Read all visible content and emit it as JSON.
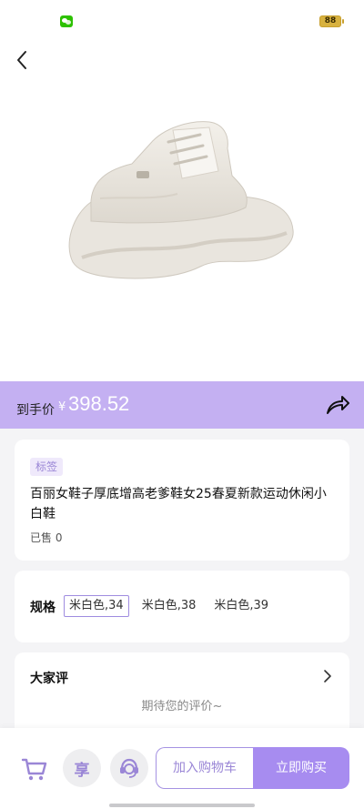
{
  "status_bar": {
    "battery": "88"
  },
  "product": {
    "price_label": "到手价",
    "currency": "¥",
    "price": "398.52",
    "tag": "标签",
    "title": "百丽女鞋子厚底增高老爹鞋女25春夏新款运动休闲小白鞋",
    "sold": "已售 0"
  },
  "spec": {
    "label": "规格",
    "options": [
      "米白色,34",
      "米白色,38",
      "米白色,39"
    ],
    "selected_index": 0
  },
  "reviews": {
    "title": "大家评",
    "empty_text": "期待您的评价~"
  },
  "actions": {
    "add_to_cart": "加入购物车",
    "buy_now": "立即购买",
    "share_earn_glyph": "享"
  },
  "colors": {
    "accent": "#a78cf0",
    "price_bar": "#c4b0f2",
    "tag_bg": "#efe9fb",
    "wechat_green": "#2dc100"
  },
  "icons": {
    "back": "chevron-left-icon",
    "share": "share-arrow-icon",
    "cart": "cart-icon",
    "service": "customer-service-icon",
    "review_more": "chevron-right-icon"
  }
}
